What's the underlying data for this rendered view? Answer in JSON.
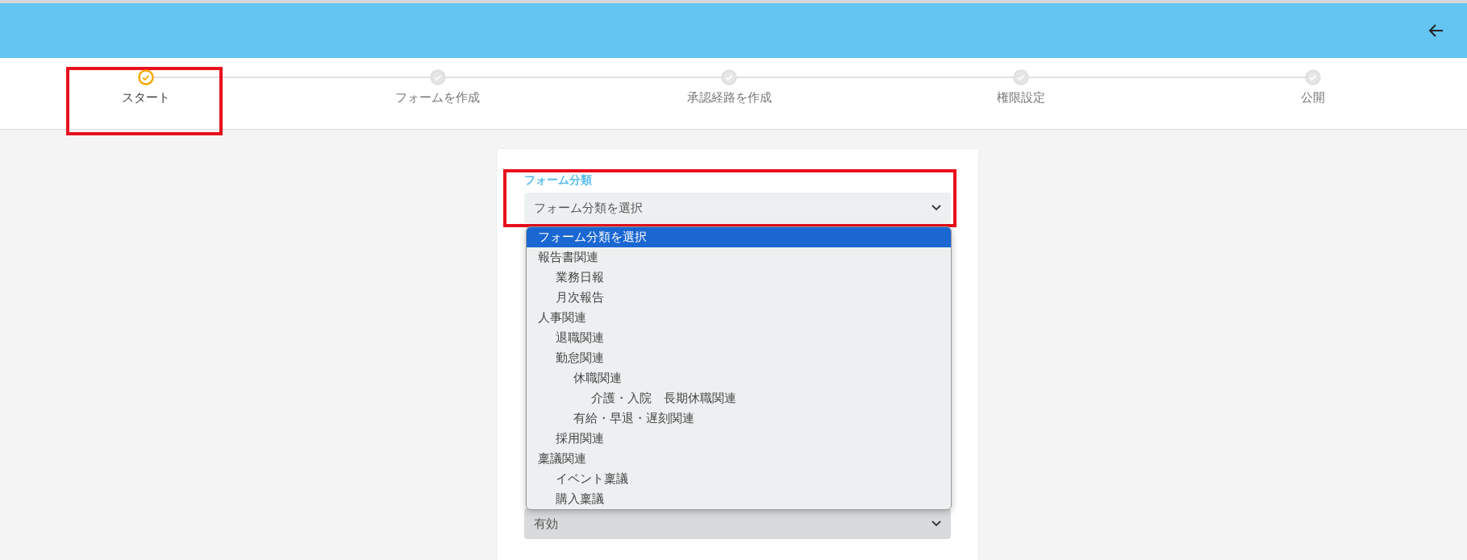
{
  "steps": [
    {
      "label": "スタート",
      "selected": true
    },
    {
      "label": "フォームを作成",
      "selected": false
    },
    {
      "label": "承認経路を作成",
      "selected": false
    },
    {
      "label": "権限設定",
      "selected": false
    },
    {
      "label": "公開",
      "selected": false
    }
  ],
  "form_category": {
    "label": "フォーム分類",
    "value": "フォーム分類を選択",
    "options": [
      {
        "label": "フォーム分類を選択",
        "selected": true
      },
      {
        "label": "報告書関連",
        "selected": false,
        "children": [
          {
            "label": "業務日報",
            "selected": false
          },
          {
            "label": "月次報告",
            "selected": false
          }
        ]
      },
      {
        "label": "人事関連",
        "selected": false,
        "children": [
          {
            "label": "退職関連",
            "selected": false
          },
          {
            "label": "勤怠関連",
            "selected": false,
            "children": [
              {
                "label": "休職関連",
                "selected": false,
                "children": [
                  {
                    "label": "介護・入院　長期休職関連",
                    "selected": false
                  }
                ]
              },
              {
                "label": "有給・早退・遅刻関連",
                "selected": false
              }
            ]
          },
          {
            "label": "採用関連",
            "selected": false
          }
        ]
      },
      {
        "label": "稟議関連",
        "selected": false,
        "children": [
          {
            "label": "イベント稟議",
            "selected": false
          },
          {
            "label": "購入稟議",
            "selected": false
          }
        ]
      }
    ]
  },
  "status_select": {
    "value": "有効"
  }
}
